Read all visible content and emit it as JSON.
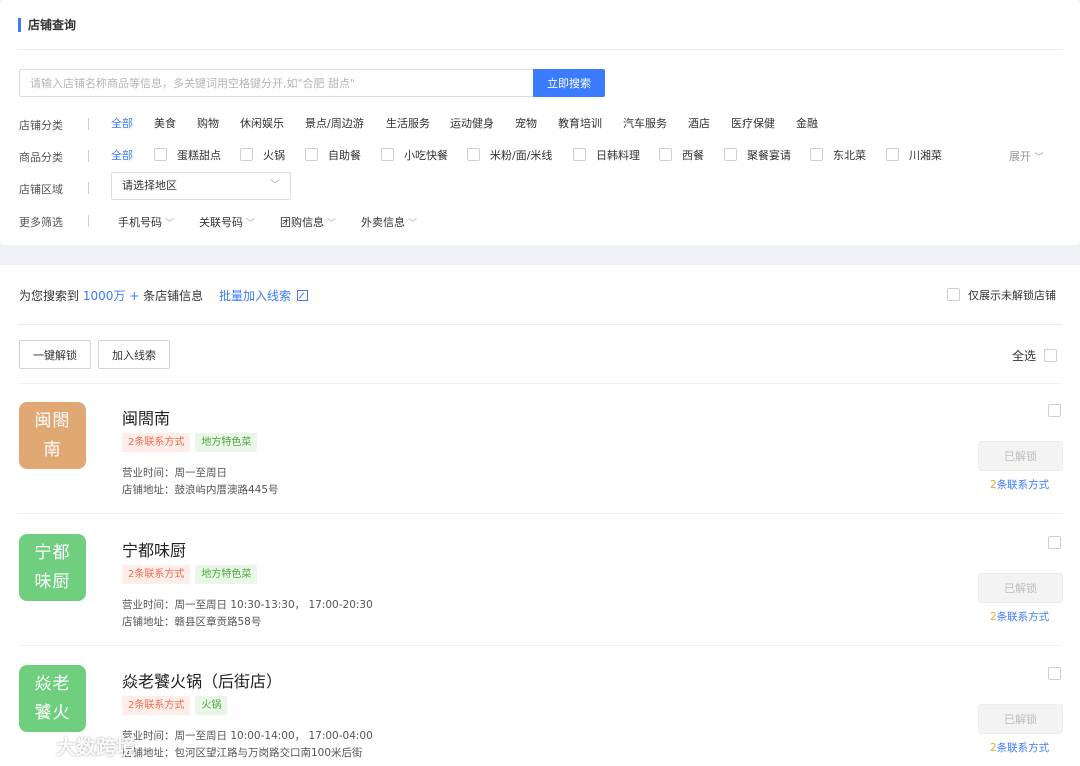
{
  "header": {
    "title": "店铺查询"
  },
  "search": {
    "placeholder": "请输入店铺名称商品等信息，多关键词用空格键分开,如\"合肥 甜点\"",
    "button": "立即搜索"
  },
  "filters": {
    "shop_category": {
      "label": "店铺分类",
      "options": [
        "全部",
        "美食",
        "购物",
        "休闲娱乐",
        "景点/周边游",
        "生活服务",
        "运动健身",
        "宠物",
        "教育培训",
        "汽车服务",
        "酒店",
        "医疗保健",
        "金融"
      ],
      "selected": "全部"
    },
    "product_category": {
      "label": "商品分类",
      "all": "全部",
      "options": [
        "蛋糕甜点",
        "火锅",
        "自助餐",
        "小吃快餐",
        "米粉/面/米线",
        "日韩料理",
        "西餐",
        "聚餐宴请",
        "东北菜",
        "川湘菜"
      ],
      "expand": "展开"
    },
    "region": {
      "label": "店铺区域",
      "placeholder": "请选择地区"
    },
    "more": {
      "label": "更多筛选",
      "dropdowns": [
        "手机号码",
        "关联号码",
        "团购信息",
        "外卖信息"
      ]
    }
  },
  "results": {
    "summary_prefix": "为您搜索到",
    "count": "1000万 +",
    "summary_suffix": "条店铺信息",
    "batch_link": "批量加入线索",
    "only_unlocked": "仅展示未解锁店铺",
    "unlock_all": "一键解锁",
    "add_lead": "加入线索",
    "select_all": "全选"
  },
  "shops": [
    {
      "avatar_line1": "闽閤",
      "avatar_line2": "南",
      "avatar_color": "#e0a974",
      "name": "闽閤南",
      "tags": [
        {
          "text": "2条联系方式",
          "type": "red"
        },
        {
          "text": "地方特色菜",
          "type": "green"
        }
      ],
      "hours": "营业时间：周一至周日",
      "address": "店铺地址：鼓浪屿内厝澳路445号",
      "button": "已解锁",
      "contact_num": "2",
      "contact_text": "条联系方式"
    },
    {
      "avatar_line1": "宁都",
      "avatar_line2": "味厨",
      "avatar_color": "#6fcf7e",
      "name": "宁都味厨",
      "tags": [
        {
          "text": "2条联系方式",
          "type": "red"
        },
        {
          "text": "地方特色菜",
          "type": "green"
        }
      ],
      "hours": "营业时间：周一至周日 10:30-13:30， 17:00-20:30",
      "address": "店铺地址：赣县区章贡路58号",
      "button": "已解锁",
      "contact_num": "2",
      "contact_text": "条联系方式"
    },
    {
      "avatar_line1": "焱老",
      "avatar_line2": "饕火",
      "avatar_color": "#6fcf7e",
      "name": "焱老饕火锅（后街店）",
      "tags": [
        {
          "text": "2条联系方式",
          "type": "red"
        },
        {
          "text": "火锅",
          "type": "green"
        }
      ],
      "hours": "营业时间：周一至周日 10:00-14:00， 17:00-04:00",
      "address": "店铺地址：包河区望江路与万岗路交口南100米后街",
      "button": "已解锁",
      "contact_num": "2",
      "contact_text": "条联系方式"
    }
  ],
  "watermark": "大数跨境"
}
